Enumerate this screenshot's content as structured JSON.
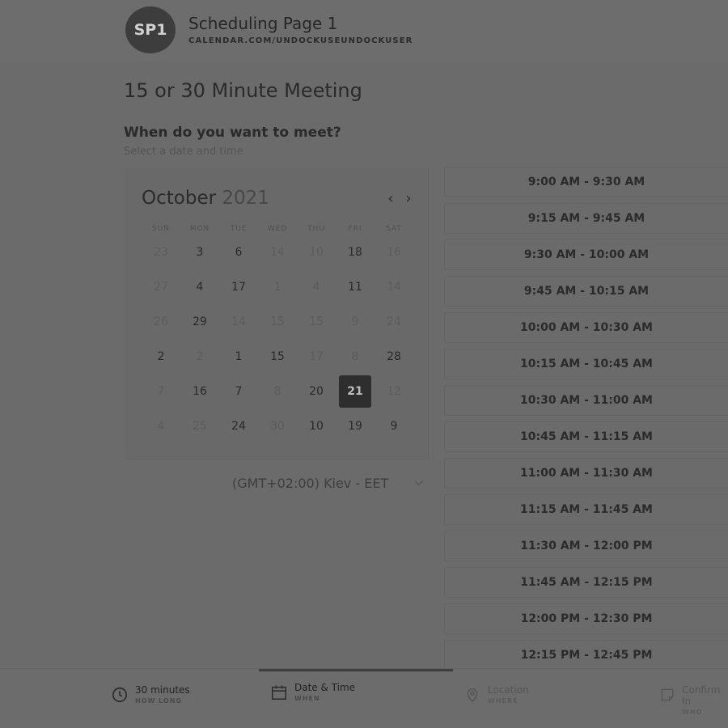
{
  "header": {
    "avatar_initials": "SP1",
    "page_name": "Scheduling Page 1",
    "page_url": "CALENDAR.COM/UNDOCKUSEUNDOCKUSER"
  },
  "meeting_title": "15 or 30 Minute Meeting",
  "question": "When do you want to meet?",
  "question_sub": "Select a date and time",
  "calendar": {
    "month": "October",
    "year": "2021",
    "weekdays": [
      "SUN",
      "MON",
      "TUE",
      "WED",
      "THU",
      "FRI",
      "SAT"
    ],
    "weeks": [
      [
        "23",
        "3",
        "6",
        "14",
        "10",
        "18",
        "16"
      ],
      [
        "27",
        "4",
        "17",
        "1",
        "4",
        "11",
        "14"
      ],
      [
        "26",
        "29",
        "14",
        "15",
        "15",
        "9",
        "24"
      ],
      [
        "2",
        "2",
        "1",
        "15",
        "17",
        "8",
        "28"
      ],
      [
        "7",
        "16",
        "7",
        "8",
        "20",
        "21",
        "12"
      ],
      [
        "4",
        "25",
        "24",
        "30",
        "10",
        "19",
        "9"
      ]
    ],
    "selected": "21"
  },
  "timezone": "(GMT+02:00) Kiev - EET",
  "time_slots": [
    "9:00 AM - 9:30 AM",
    "9:15 AM - 9:45 AM",
    "9:30 AM - 10:00 AM",
    "9:45 AM - 10:15 AM",
    "10:00 AM - 10:30 AM",
    "10:15 AM - 10:45 AM",
    "10:30 AM - 11:00 AM",
    "10:45 AM - 11:15 AM",
    "11:00 AM - 11:30 AM",
    "11:15 AM - 11:45 AM",
    "11:30 AM - 12:00 PM",
    "11:45 AM - 12:15 PM",
    "12:00 PM - 12:30 PM",
    "12:15 PM - 12:45 PM"
  ],
  "steps": [
    {
      "label": "30 minutes",
      "sub": "HOW LONG",
      "icon": "clock-icon"
    },
    {
      "label": "Date & Time",
      "sub": "WHEN",
      "icon": "calendar-icon"
    },
    {
      "label": "Location",
      "sub": "WHERE",
      "icon": "location-pin-icon"
    },
    {
      "label": "Confirm In",
      "sub": "WHO",
      "icon": "form-icon"
    }
  ]
}
